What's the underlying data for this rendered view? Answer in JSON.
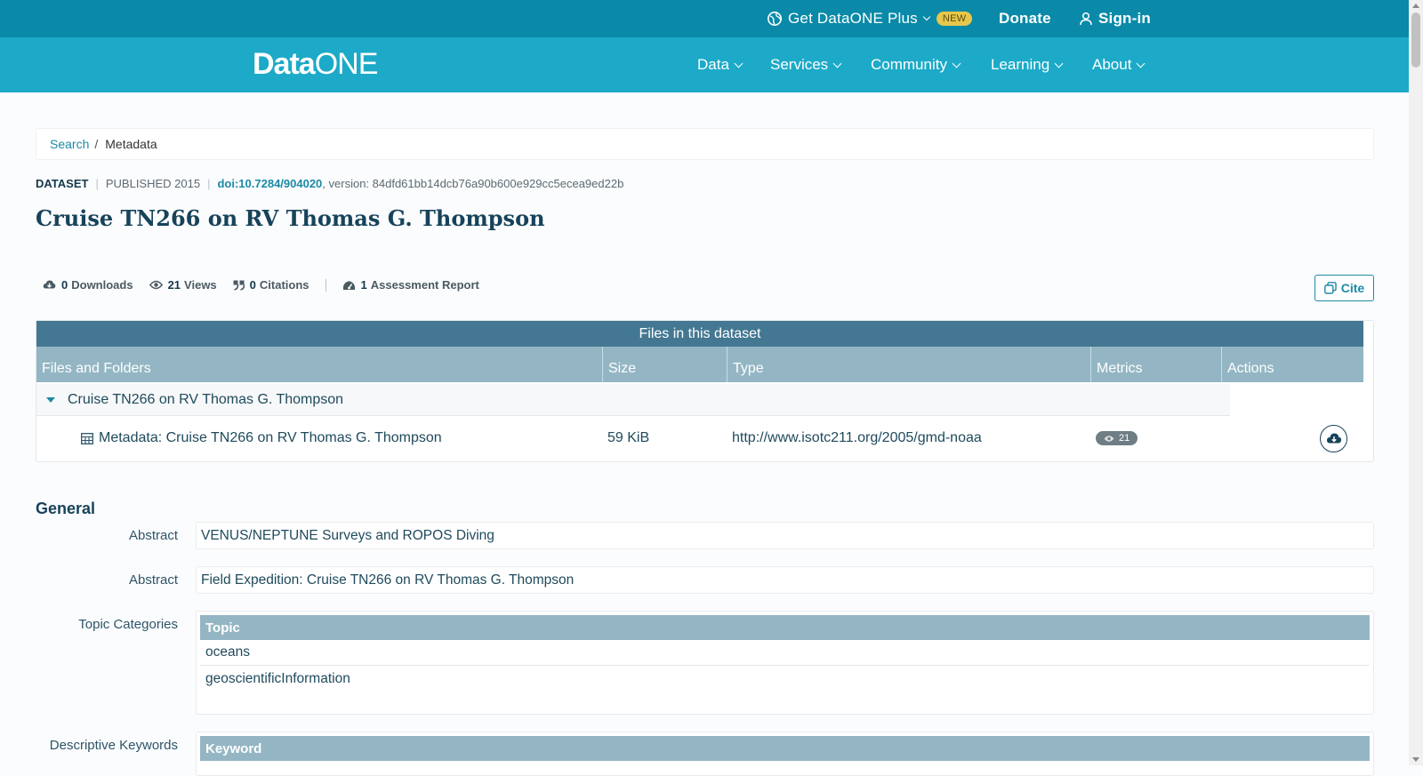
{
  "topbar": {
    "plus_label": "Get DataONE Plus",
    "new_badge": "NEW",
    "donate": "Donate",
    "signin": "Sign-in"
  },
  "logo": {
    "data": "Data",
    "one": "ONE"
  },
  "nav": {
    "items": [
      {
        "label": "Data"
      },
      {
        "label": "Services"
      },
      {
        "label": "Community"
      },
      {
        "label": "Learning"
      },
      {
        "label": "About"
      }
    ]
  },
  "breadcrumb": {
    "search": "Search",
    "separator": "/",
    "current": "Metadata"
  },
  "dataset": {
    "type": "DATASET",
    "published": "PUBLISHED 2015",
    "doi": "doi:10.7284/904020",
    "version": ", version: 84dfd61bb14dcb76a90b600e929cc5ecea9ed22b",
    "title": "Cruise TN266 on RV Thomas G. Thompson"
  },
  "metrics": {
    "downloads_count": "0",
    "downloads_label": "Downloads",
    "views_count": "21",
    "views_label": "Views",
    "citations_count": "0",
    "citations_label": "Citations",
    "assessment_count": "1",
    "assessment_label": "Assessment Report"
  },
  "cite_button": "Cite",
  "files_table": {
    "caption": "Files in this dataset",
    "columns": [
      "Files and Folders",
      "Size",
      "Type",
      "Metrics",
      "Actions"
    ],
    "folder": "Cruise TN266 on RV Thomas G. Thompson",
    "file": {
      "name": "Metadata: Cruise TN266 on RV Thomas G. Thompson",
      "size": "59 KiB",
      "type": "http://www.isotc211.org/2005/gmd-noaa",
      "views": "21"
    }
  },
  "general": {
    "title": "General",
    "abstract_label_1": "Abstract",
    "abstract_1": "VENUS/NEPTUNE Surveys and ROPOS Diving",
    "abstract_label_2": "Abstract",
    "abstract_2": "Field Expedition: Cruise TN266 on RV Thomas G. Thompson",
    "topic_label": "Topic Categories",
    "topic_header": "Topic",
    "topics": [
      "oceans",
      "geoscientificInformation"
    ],
    "keywords_label": "Descriptive Keywords",
    "keyword_header": "Keyword"
  },
  "colors": {
    "topbar": "#0a8aa8",
    "navbar": "#1caac8",
    "table_caption": "#447892",
    "table_header": "#94b6c4",
    "link": "#1b8aa5",
    "new_badge": "#e6c74b"
  },
  "icons": [
    "globe-icon",
    "user-icon",
    "cloud-download-icon",
    "eye-icon",
    "quote-icon",
    "gauge-icon",
    "copy-icon",
    "table-icon",
    "caret-down-icon",
    "chevron-down-icon"
  ]
}
